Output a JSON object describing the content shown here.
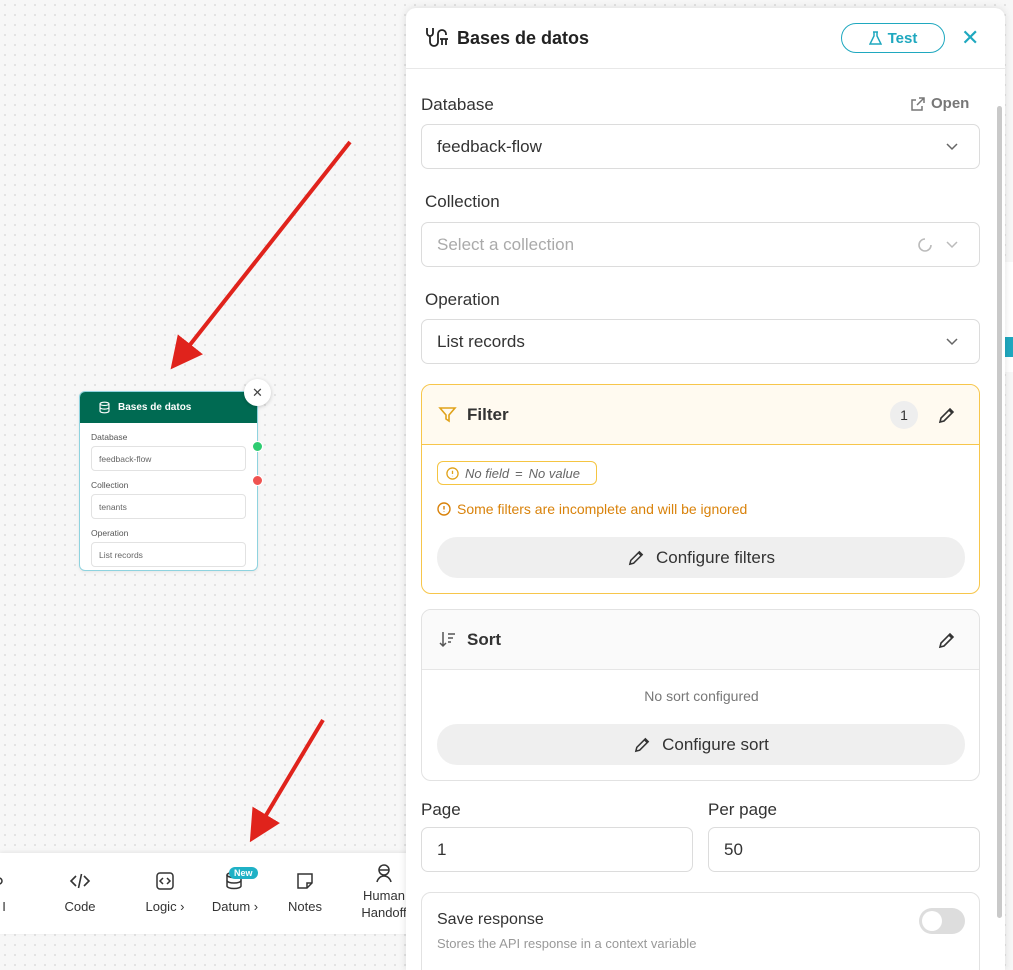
{
  "node": {
    "title": "Bases de datos",
    "close": "✕",
    "fields": [
      {
        "label": "Database",
        "value": "feedback-flow"
      },
      {
        "label": "Collection",
        "value": "tenants"
      },
      {
        "label": "Operation",
        "value": "List records"
      }
    ]
  },
  "toolbar": {
    "items": [
      {
        "label": "I"
      },
      {
        "label": "Code"
      },
      {
        "label": "Logic ›"
      },
      {
        "label": "Datum ›",
        "badge": "New"
      },
      {
        "label": "Notes"
      },
      {
        "label": "Human Handoff"
      }
    ]
  },
  "panel": {
    "title": "Bases de datos",
    "test_label": "Test",
    "close": "✕",
    "database": {
      "label": "Database",
      "open_label": "Open",
      "value": "feedback-flow"
    },
    "collection": {
      "label": "Collection",
      "placeholder": "Select a collection"
    },
    "operation": {
      "label": "Operation",
      "value": "List records"
    },
    "filter": {
      "title": "Filter",
      "count": "1",
      "chip_field": "No field",
      "chip_op": "=",
      "chip_value": "No value",
      "warning": "Some filters are incomplete and will be ignored",
      "configure_label": "Configure filters"
    },
    "sort": {
      "title": "Sort",
      "empty": "No sort configured",
      "configure_label": "Configure sort"
    },
    "page": {
      "label": "Page",
      "value": "1"
    },
    "per_page": {
      "label": "Per page",
      "value": "50"
    },
    "save_response": {
      "title": "Save response",
      "description": "Stores the API response in a context variable",
      "enabled": false
    }
  },
  "colors": {
    "accent": "#1fa8bf",
    "node_header": "#006a52",
    "warning": "#d9820a",
    "filter_border": "#f7c64b",
    "arrow": "#e0231c"
  }
}
